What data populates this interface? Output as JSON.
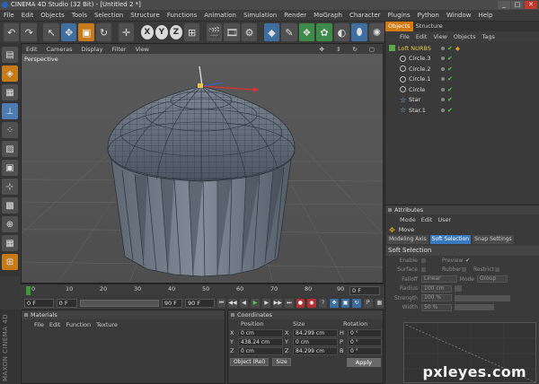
{
  "window": {
    "title": "CINEMA 4D Studio (32 Bit) - [Untitled 2 *]",
    "controls": [
      "_",
      "□",
      "✕"
    ]
  },
  "menu": [
    "File",
    "Edit",
    "Objects",
    "Tools",
    "Selection",
    "Structure",
    "Functions",
    "Animation",
    "Simulation",
    "Render",
    "MoGraph",
    "Character",
    "Plugins",
    "Python",
    "Window",
    "Help"
  ],
  "viewport": {
    "menu": [
      "Edit",
      "Cameras",
      "Display",
      "Filter",
      "View"
    ],
    "label": "Perspective"
  },
  "timeline": {
    "ticks": [
      "0",
      "10",
      "20",
      "30",
      "40",
      "50",
      "60",
      "70",
      "80",
      "90"
    ],
    "current_frame": "0 F"
  },
  "transport": {
    "start": "0 F",
    "current": "0 F",
    "end": "90 F",
    "end2": "90 F"
  },
  "materials": {
    "title": "Materials",
    "menu": [
      "File",
      "Edit",
      "Function",
      "Texture"
    ]
  },
  "coordinates": {
    "title": "Coordinates",
    "headers": [
      "Position",
      "Size",
      "Rotation"
    ],
    "rows": [
      {
        "axis": "X",
        "pos": "0 cm",
        "saxis": "X",
        "size": "84.299 cm",
        "raxis": "H",
        "rot": "0 °"
      },
      {
        "axis": "Y",
        "pos": "438.24 cm",
        "saxis": "Y",
        "size": "0 cm",
        "raxis": "P",
        "rot": "0 °"
      },
      {
        "axis": "Z",
        "pos": "0 cm",
        "saxis": "Z",
        "size": "84.299 cm",
        "raxis": "B",
        "rot": "0 °"
      }
    ],
    "mode_select": "Object (Rel)",
    "size_select": "Size",
    "apply": "Apply"
  },
  "objects": {
    "tabs": [
      "Objects",
      "Structure"
    ],
    "menu": [
      "File",
      "Edit",
      "View",
      "Objects",
      "Tags"
    ],
    "items": [
      {
        "name": "Loft NURBS",
        "kind": "nurbs"
      },
      {
        "name": "Circle.3",
        "kind": "circle"
      },
      {
        "name": "Circle.2",
        "kind": "circle"
      },
      {
        "name": "Circle.1",
        "kind": "circle"
      },
      {
        "name": "Circle",
        "kind": "circle"
      },
      {
        "name": "Star",
        "kind": "star"
      },
      {
        "name": "Star.1",
        "kind": "star"
      }
    ]
  },
  "attributes": {
    "title": "Attributes",
    "menu": [
      "Mode",
      "Edit",
      "User"
    ],
    "tool": "Move",
    "tabs": [
      "Modeling Axis",
      "Soft Selection",
      "Snap Settings"
    ],
    "active_tab": "Soft Selection",
    "section": "Soft Selection",
    "enable": "Enable",
    "preview": "Preview",
    "surface": "Surface",
    "rubber": "Rubber",
    "restrict": "Restrict",
    "falloff_label": "Falloff",
    "falloff": "Linear",
    "mode_label": "Mode",
    "mode": "Group",
    "radius_label": "Radius",
    "radius": "100 cm",
    "strength_label": "Strength",
    "strength": "100 %",
    "width_label": "Width",
    "width": "50 %"
  },
  "watermark": "pxleyes.com",
  "branding": "MAXON CINEMA 4D"
}
